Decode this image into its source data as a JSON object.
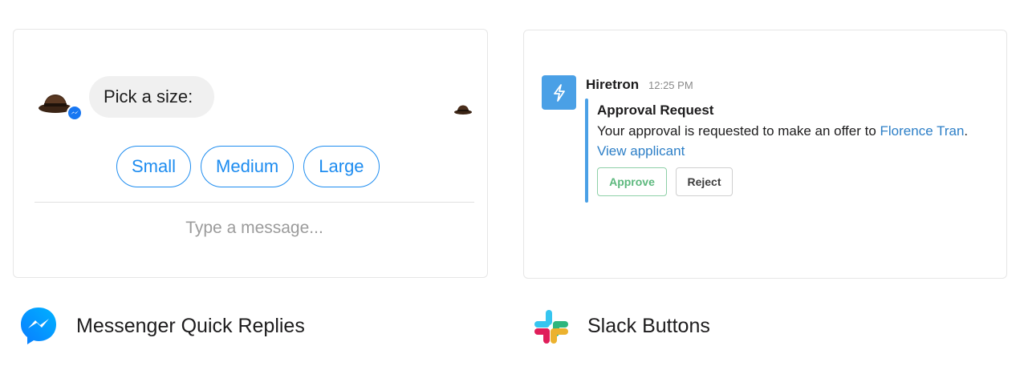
{
  "messenger": {
    "prompt": "Pick a size:",
    "quick_replies": [
      "Small",
      "Medium",
      "Large"
    ],
    "input_placeholder": "Type a message...",
    "caption": "Messenger Quick Replies",
    "accent": "#1877f2"
  },
  "slack": {
    "bot_name": "Hiretron",
    "time": "12:25 PM",
    "title": "Approval Request",
    "body_prefix": "Your approval is requested to make an offer to ",
    "body_link": "Florence Tran",
    "body_suffix": ".",
    "view_link": "View applicant",
    "approve_label": "Approve",
    "reject_label": "Reject",
    "caption": "Slack Buttons",
    "accent": "#4aa0e6"
  },
  "icons": {
    "messenger_logo": "messenger-logo-icon",
    "slack_logo": "slack-logo-icon",
    "bot_avatar": "lightning-bolt-icon",
    "user_avatar": "bowler-hat-icon"
  }
}
